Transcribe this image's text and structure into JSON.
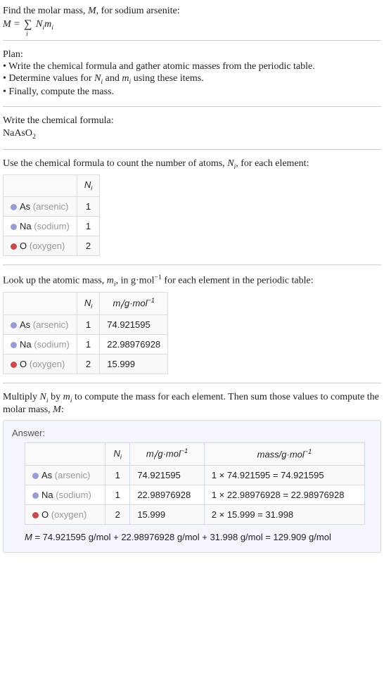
{
  "intro": {
    "line1": "Find the molar mass, ",
    "line1_var": "M",
    "line1_after": ", for sodium arsenite:",
    "eq_M": "M",
    "eq_eq": " = ",
    "eq_sigma": "∑",
    "eq_i": "i",
    "eq_Ni": "N",
    "eq_Ni_sub": "i",
    "eq_mi": "m",
    "eq_mi_sub": "i"
  },
  "plan": {
    "heading": "Plan:",
    "line1": "• Write the chemical formula and gather atomic masses from the periodic table.",
    "line2a": "• Determine values for ",
    "line2_N": "N",
    "line2_Ni": "i",
    "line2_and": " and ",
    "line2_m": "m",
    "line2_mi": "i",
    "line2b": " using these items.",
    "line3": "• Finally, compute the mass."
  },
  "chem": {
    "heading": "Write the chemical formula:",
    "formula_a": "NaAsO",
    "formula_sub": "2"
  },
  "count": {
    "heading_a": "Use the chemical formula to count the number of atoms, ",
    "heading_N": "N",
    "heading_Ni": "i",
    "heading_b": ", for each element:",
    "hdr_Ni": "N",
    "hdr_Ni_sub": "i"
  },
  "elements": [
    {
      "sym": "As",
      "name": "(arsenic)",
      "dot": "dot-as",
      "N": "1",
      "m": "74.921595",
      "mass": "1 × 74.921595 = 74.921595"
    },
    {
      "sym": "Na",
      "name": "(sodium)",
      "dot": "dot-na",
      "N": "1",
      "m": "22.98976928",
      "mass": "1 × 22.98976928 = 22.98976928"
    },
    {
      "sym": "O",
      "name": "(oxygen)",
      "dot": "dot-o",
      "N": "2",
      "m": "15.999",
      "mass": "2 × 15.999 = 31.998"
    }
  ],
  "lookup": {
    "heading_a": "Look up the atomic mass, ",
    "heading_m": "m",
    "heading_mi": "i",
    "heading_b": ", in g·mol",
    "heading_exp": "−1",
    "heading_c": " for each element in the periodic table:",
    "hdr_mi": "m",
    "hdr_mi_sub": "i",
    "hdr_unit_a": "/g·mol",
    "hdr_unit_exp": "−1"
  },
  "mult": {
    "heading_a": "Multiply ",
    "N": "N",
    "Ni": "i",
    "by": " by ",
    "m": "m",
    "mi": "i",
    "heading_b": " to compute the mass for each element. Then sum those values to compute the molar mass, ",
    "M": "M",
    "colon": ":"
  },
  "answer": {
    "label": "Answer:",
    "hdr_mass_a": "mass/g·mol",
    "hdr_mass_exp": "−1",
    "final_a": "M",
    "final_b": " = 74.921595 g/mol + 22.98976928 g/mol + 31.998 g/mol = 129.909 g/mol"
  }
}
